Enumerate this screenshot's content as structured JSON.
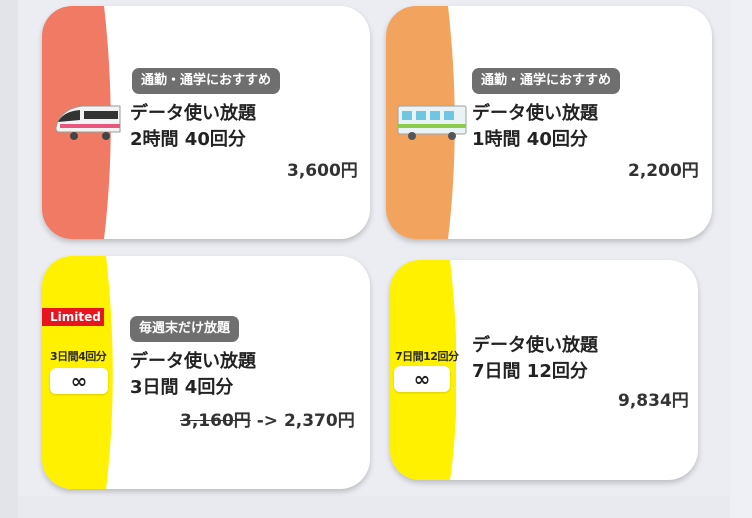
{
  "plans": [
    {
      "tag": "通勤・通学におすすめ",
      "title": "データ使い放題",
      "spec": "2時間 40回分",
      "price": "3,600円",
      "band_color": "#f07a63",
      "icon": "train-icon"
    },
    {
      "tag": "通勤・通学におすすめ",
      "title": "データ使い放題",
      "spec": "1時間 40回分",
      "price": "2,200円",
      "band_color": "#f2a35e",
      "icon": "commuter-train-icon"
    },
    {
      "tag": "毎週末だけ放題",
      "title": "データ使い放題",
      "spec": "3日間 4回分",
      "old_price": "3,160円",
      "arrow": "->",
      "price": "2,370円",
      "band_color": "#fff100",
      "limited": "Limited",
      "badge": "3日間4回分",
      "infinity": "∞"
    },
    {
      "title": "データ使い放題",
      "spec": "7日間 12回分",
      "price": "9,834円",
      "band_color": "#fff100",
      "badge": "7日間12回分",
      "infinity": "∞"
    }
  ]
}
